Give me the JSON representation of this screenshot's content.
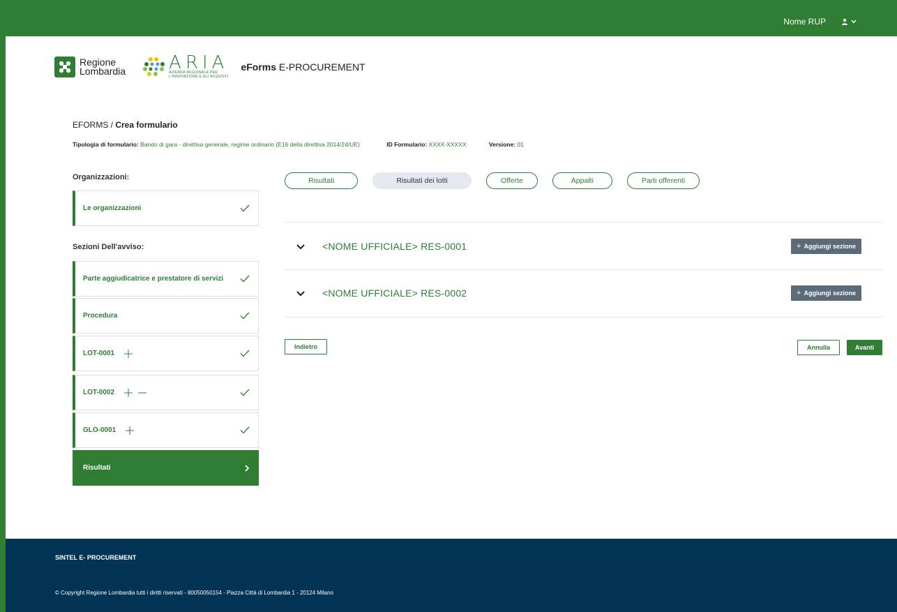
{
  "topbar": {
    "user_name": "Nome RUP"
  },
  "header": {
    "logo_rl_line1": "Regione",
    "logo_rl_line2": "Lombardia",
    "logo_aria": "ARIA",
    "logo_aria_sub1": "AZIENDA REGIONALE PER",
    "logo_aria_sub2": "L'INNOVAZIONE E GLI ACQUISTI",
    "app_title_bold": "eForms",
    "app_title_rest": " E-PROCUREMENT"
  },
  "breadcrumb": {
    "root": "EFORMS / ",
    "current": "Crea formulario"
  },
  "meta": {
    "tipologia_label": "Tipologia di formulario:",
    "tipologia_value": "Bando di gara - direttiva generale, regime ordinario (E16 della direttiva 2014/24/UE)",
    "id_label": "ID Formulario:",
    "id_value": "XXXX-XXXXX",
    "versione_label": "Versione:",
    "versione_value": "01"
  },
  "sidebar": {
    "org_label": "Organizzazioni:",
    "org_item": "Le organizzazioni",
    "sections_label": "Sezioni Dell'avviso:",
    "items": [
      {
        "label": "Parte aggiudicatrice e prestatore di servizi"
      },
      {
        "label": "Procedura"
      },
      {
        "label": "LOT-0001"
      },
      {
        "label": "LOT-0002"
      },
      {
        "label": "GLO-0001"
      },
      {
        "label": "Risultati"
      }
    ]
  },
  "tabs": [
    {
      "label": "Risultati"
    },
    {
      "label": "Risultati dei lotti"
    },
    {
      "label": "Offerte"
    },
    {
      "label": "Appalti"
    },
    {
      "label": "Parti offerenti"
    }
  ],
  "accordions": [
    {
      "title": "<NOME UFFICIALE> RES-0001",
      "add_label": "Aggiungi sezione"
    },
    {
      "title": "<NOME UFFICIALE> RES-0002",
      "add_label": "Aggiungi sezione"
    }
  ],
  "actions": {
    "back": "Indietro",
    "cancel": "Annulla",
    "next": "Avanti"
  },
  "footer": {
    "brand": "SINTEL E- PROCUREMENT",
    "copyright": "© Copyright Regione Lombardia tutti i diritti riservati - 80050050154 - Piazza Città di Lombardia 1 - 20124 Milano"
  },
  "colors": {
    "primary": "#2e7d32",
    "footer": "#003354",
    "add_button": "#5b6b7a",
    "active_tab": "#e4e9ef"
  }
}
